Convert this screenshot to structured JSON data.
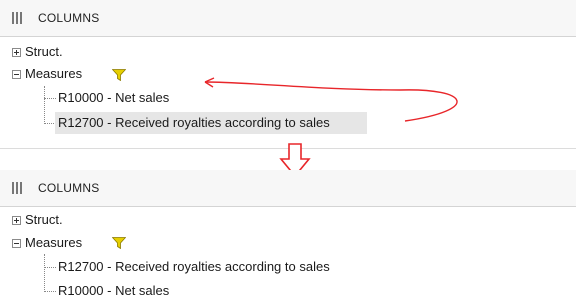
{
  "before": {
    "header_title": "COLUMNS",
    "tree": [
      {
        "label": "Struct.",
        "expander": "plus"
      },
      {
        "label": "Measures",
        "expander": "minus",
        "filter_icon": "funnel-icon",
        "children": [
          {
            "label": "R10000 - Net sales"
          },
          {
            "label": "R12700 - Received royalties according to sales",
            "selected": true
          }
        ]
      }
    ]
  },
  "after": {
    "header_title": "COLUMNS",
    "tree": [
      {
        "label": "Struct.",
        "expander": "plus"
      },
      {
        "label": "Measures",
        "expander": "minus",
        "filter_icon": "funnel-icon",
        "children": [
          {
            "label": "R12700 - Received royalties according to sales"
          },
          {
            "label": "R10000 - Net sales"
          }
        ]
      }
    ]
  },
  "annotations": {
    "move_arrow_color": "#e8262a",
    "down_arrow_color": "#e8262a",
    "funnel_color": "#e6cf00"
  }
}
